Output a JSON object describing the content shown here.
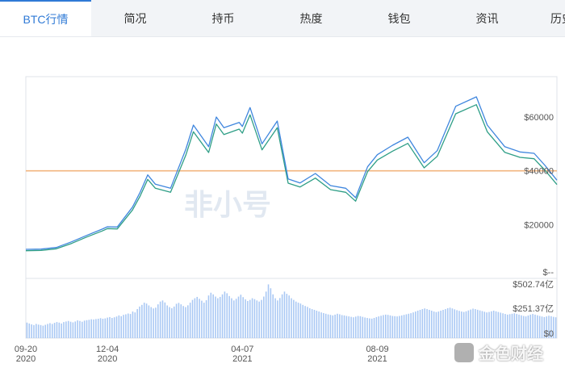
{
  "tabs": [
    {
      "label": "BTC行情",
      "active": true
    },
    {
      "label": "简况",
      "active": false
    },
    {
      "label": "持币",
      "active": false
    },
    {
      "label": "热度",
      "active": false
    },
    {
      "label": "钱包",
      "active": false
    },
    {
      "label": "资讯",
      "active": false
    },
    {
      "label": "历史",
      "active": false
    }
  ],
  "watermark": {
    "center": "非小号",
    "corner": "金色财经"
  },
  "colors": {
    "price_line": "#3f86de",
    "second_line": "#2e9e86",
    "reference_line": "#f2b57f",
    "volume_bar": "#a9c8f4",
    "active_tab": "#2f7ad6"
  },
  "chart_data": {
    "type": "line",
    "x": [
      "2020-09-20",
      "2020-10-04",
      "2020-10-18",
      "2020-11-01",
      "2020-11-15",
      "2020-11-29",
      "2020-12-04",
      "2020-12-13",
      "2020-12-27",
      "2021-01-03",
      "2021-01-10",
      "2021-01-17",
      "2021-01-31",
      "2021-02-14",
      "2021-02-21",
      "2021-03-07",
      "2021-03-14",
      "2021-03-21",
      "2021-04-04",
      "2021-04-07",
      "2021-04-14",
      "2021-04-25",
      "2021-05-09",
      "2021-05-19",
      "2021-05-30",
      "2021-06-13",
      "2021-06-27",
      "2021-07-11",
      "2021-07-20",
      "2021-07-31",
      "2021-08-09",
      "2021-08-23",
      "2021-09-06",
      "2021-09-21",
      "2021-10-03",
      "2021-10-20",
      "2021-11-08",
      "2021-11-18",
      "2021-12-04",
      "2021-12-18",
      "2021-12-31",
      "2022-01-10",
      "2022-01-21"
    ],
    "series": [
      {
        "values": [
          10800,
          10900,
          11500,
          13600,
          16000,
          18300,
          19200,
          19100,
          26500,
          32000,
          38500,
          35000,
          33500,
          48000,
          57000,
          49000,
          60000,
          56000,
          58000,
          56500,
          63500,
          50000,
          58500,
          37000,
          35500,
          39000,
          34500,
          33500,
          30000,
          41500,
          46000,
          49500,
          52500,
          43000,
          47500,
          64000,
          67500,
          57000,
          49000,
          47000,
          46500,
          42000,
          36500
        ]
      },
      {
        "values": [
          10300,
          10400,
          11000,
          13000,
          15400,
          17600,
          18500,
          18400,
          25400,
          30600,
          36800,
          33500,
          32000,
          45800,
          54500,
          46800,
          57400,
          53500,
          55500,
          54000,
          60800,
          47800,
          56000,
          35400,
          34000,
          37300,
          33000,
          32000,
          28700,
          39700,
          44000,
          47300,
          50200,
          41100,
          45400,
          61200,
          64600,
          54500,
          46900,
          45000,
          44500,
          40200,
          34900
        ]
      }
    ],
    "reference_line": 40000,
    "yticks": [
      "$60000",
      "$40000",
      "$20000",
      "$--"
    ],
    "ylim": [
      0,
      75000
    ],
    "volume": {
      "yticks": [
        "$502.74亿",
        "$251.37亿",
        "$0"
      ],
      "max": 502.74,
      "values": [
        140,
        132,
        124,
        118,
        128,
        122,
        118,
        112,
        120,
        128,
        135,
        128,
        138,
        145,
        140,
        132,
        145,
        150,
        155,
        148,
        142,
        150,
        160,
        155,
        148,
        158,
        162,
        165,
        170,
        168,
        172,
        175,
        180,
        175,
        178,
        185,
        190,
        182,
        188,
        195,
        205,
        198,
        210,
        215,
        222,
        218,
        240,
        232,
        262,
        285,
        300,
        320,
        312,
        295,
        280,
        268,
        275,
        305,
        330,
        340,
        322,
        295,
        280,
        270,
        285,
        310,
        318,
        305,
        290,
        280,
        296,
        320,
        345,
        360,
        372,
        355,
        338,
        320,
        342,
        385,
        410,
        395,
        375,
        360,
        372,
        395,
        420,
        405,
        380,
        360,
        340,
        355,
        375,
        392,
        370,
        350,
        335,
        345,
        360,
        352,
        340,
        330,
        345,
        375,
        420,
        485,
        450,
        395,
        360,
        340,
        362,
        395,
        420,
        400,
        385,
        360,
        345,
        330,
        320,
        312,
        300,
        290,
        282,
        270,
        262,
        255,
        248,
        240,
        232,
        226,
        220,
        214,
        210,
        205,
        212,
        220,
        215,
        208,
        205,
        200,
        196,
        192,
        188,
        194,
        200,
        198,
        192,
        186,
        182,
        178,
        176,
        182,
        190,
        196,
        202,
        208,
        212,
        210,
        205,
        200,
        198,
        196,
        200,
        205,
        210,
        215,
        220,
        225,
        232,
        240,
        248,
        255,
        262,
        268,
        262,
        255,
        248,
        240,
        235,
        240,
        248,
        255,
        262,
        270,
        275,
        268,
        260,
        252,
        246,
        240,
        236,
        242,
        250,
        258,
        266,
        262,
        256,
        250,
        244,
        238,
        232,
        236,
        242,
        248,
        242,
        236,
        230,
        224,
        218,
        212,
        216,
        220,
        224,
        218,
        212,
        206,
        200,
        196,
        204,
        212,
        218,
        212,
        206,
        200,
        195,
        190,
        196,
        202,
        198,
        192,
        188
      ]
    }
  }
}
